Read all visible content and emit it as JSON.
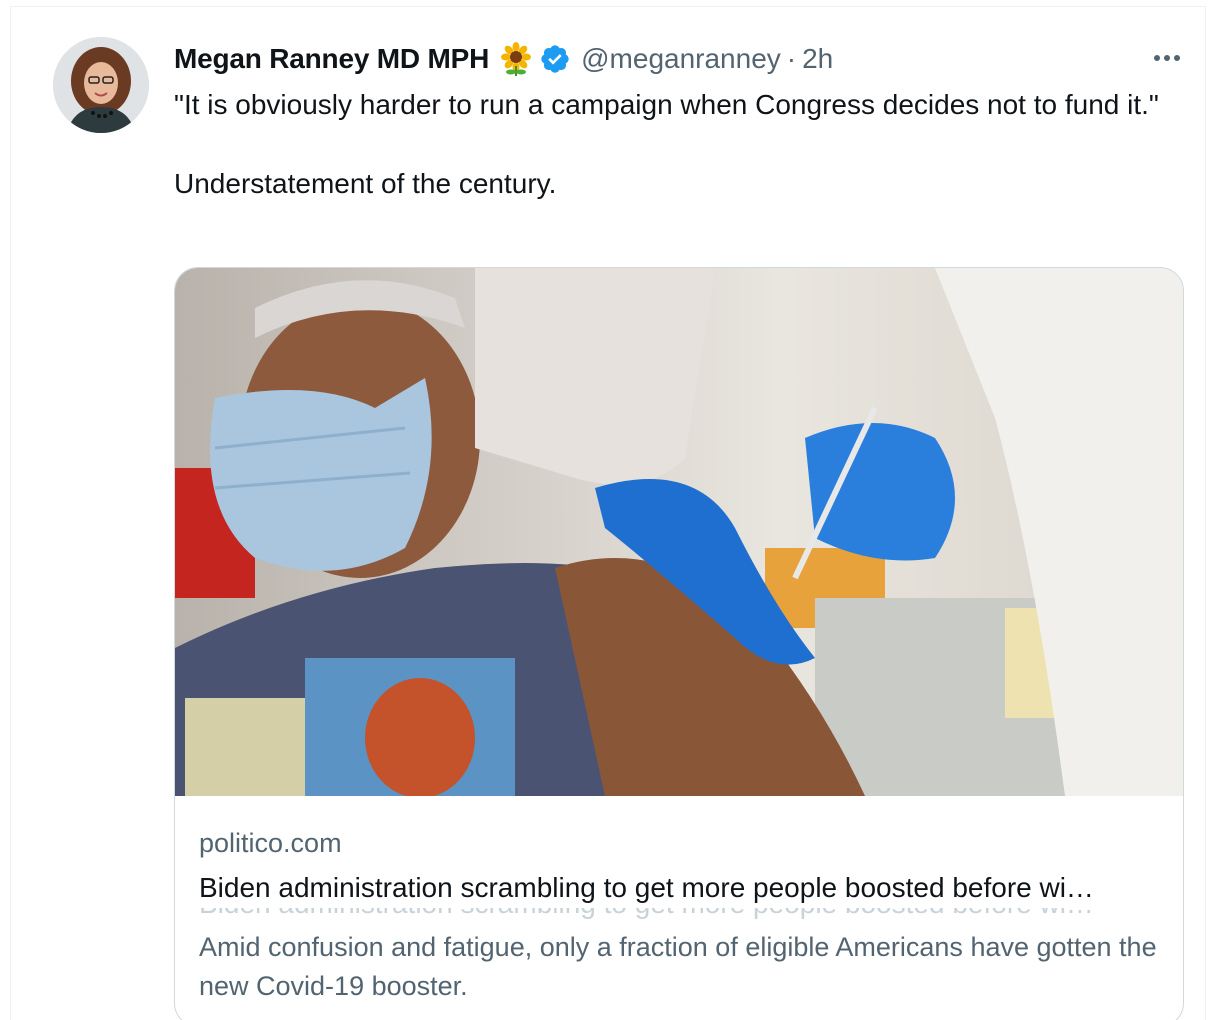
{
  "tweet": {
    "author": {
      "display_name": "Megan Ranney MD MPH",
      "emoji": "sunflower-icon",
      "verified": true,
      "handle": "@meganranney",
      "separator": "·",
      "time": "2h"
    },
    "text": {
      "line1": "\"It is obviously harder to run a campaign when Congress decides not to fund it.\"",
      "line2": "Understatement of the century."
    },
    "more_icon": "more-horizontal-icon"
  },
  "card": {
    "domain": "politico.com",
    "title": "Biden administration scrambling to get more people boosted before wi…",
    "description": "Amid confusion and fatigue, only a fraction of eligible Americans have gotten the new Covid-19 booster."
  },
  "colors": {
    "text_primary": "#0f1419",
    "text_secondary": "#536471",
    "verified_blue": "#1d9bf0",
    "border": "#cfd9de"
  }
}
